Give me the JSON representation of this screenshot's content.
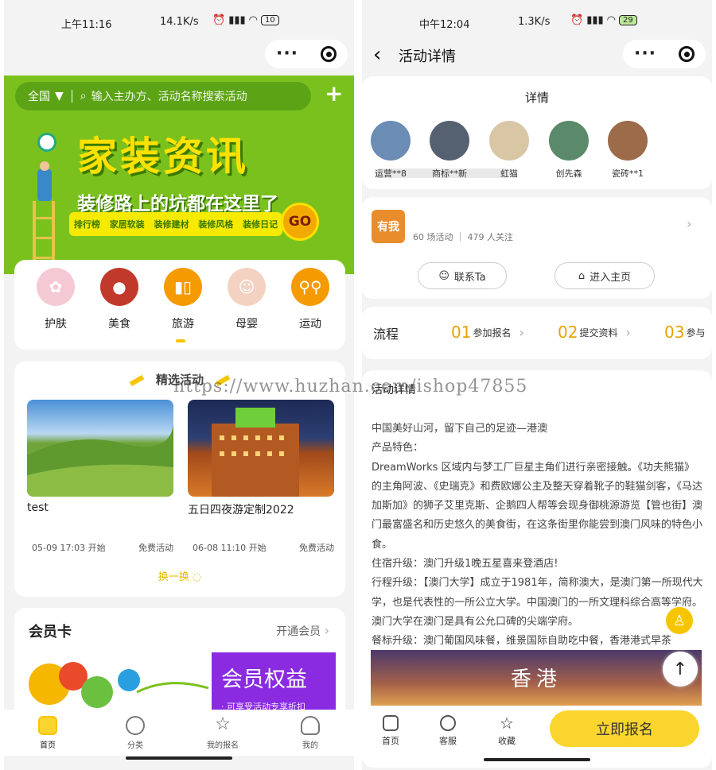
{
  "left": {
    "status": {
      "time": "上午11:16",
      "speed": "14.1K/s",
      "battery": "10"
    },
    "search": {
      "region": "全国",
      "placeholder": "输入主办方、活动名称搜索活动"
    },
    "banner": {
      "title": "家装资讯",
      "subtitle": "装修路上的坑都在这里了",
      "tags": [
        "排行榜",
        "家居软装",
        "装修建材",
        "装修风格",
        "装修日记"
      ],
      "go": "GO"
    },
    "categories": [
      {
        "label": "护肤",
        "icon": "skincare-icon",
        "color": "#f4c9d4"
      },
      {
        "label": "美食",
        "icon": "food-icon",
        "color": "#c0392b"
      },
      {
        "label": "旅游",
        "icon": "travel-icon",
        "color": "#f59a00"
      },
      {
        "label": "母婴",
        "icon": "baby-icon",
        "color": "#f3d2c1"
      },
      {
        "label": "运动",
        "icon": "bike-icon",
        "color": "#f59a00"
      }
    ],
    "featured": {
      "title": "精选活动",
      "items": [
        {
          "name": "test",
          "time": "05-09 17:03 开始",
          "price": "免费活动"
        },
        {
          "name": "五日四夜游定制2022",
          "time": "06-08 11:10 开始",
          "price": "免费活动"
        }
      ],
      "refresh": "换一换"
    },
    "member": {
      "title": "会员卡",
      "open": "开通会员",
      "banner_title": "会员权益",
      "banner_sub": "· 可享受活动专享折扣"
    },
    "tabs": [
      {
        "label": "首页",
        "icon": "home-icon",
        "active": true
      },
      {
        "label": "分类",
        "icon": "category-icon"
      },
      {
        "label": "我的报名",
        "icon": "star-icon"
      },
      {
        "label": "我的",
        "icon": "user-icon"
      }
    ]
  },
  "right": {
    "status": {
      "time": "中午12:04",
      "speed": "1.3K/s",
      "battery": "29"
    },
    "nav": {
      "title": "活动详情"
    },
    "detail_header": "详情",
    "users": [
      {
        "name": "运营**8",
        "color": "#6b8cb5"
      },
      {
        "name": "商标**新",
        "color": "#556070"
      },
      {
        "name": "虹猫",
        "color": "#d9c6a5"
      },
      {
        "name": "创先森",
        "color": "#5a8a6a"
      },
      {
        "name": "瓷砖**1",
        "color": "#9c6b4a"
      }
    ],
    "org": {
      "logo": "有我",
      "meta": "60 场活动 ｜ 479 人关注",
      "contact": "联系Ta",
      "homepage": "进入主页"
    },
    "flow": {
      "title": "流程",
      "steps": [
        {
          "no": "01",
          "label": "参加报名"
        },
        {
          "no": "02",
          "label": "提交资料"
        },
        {
          "no": "03",
          "label": "参与"
        }
      ]
    },
    "details": {
      "heading": "活动详情",
      "lines": [
        "中国美好山河，留下自己的足迹—港澳",
        "产品特色：",
        "DreamWorks 区域内与梦工厂巨星主角们进行亲密接触。《功夫熊猫》的主角阿波、《史瑞克》和费欧娜公主及整天穿着靴子的鞋猫剑客，《马达加斯加》的狮子艾里克斯、企鹅四人帮等会现身御桃源游览【管也街】澳门最富盛名和历史悠久的美食街，在这条街里你能尝到澳门风味的特色小食。",
        "住宿升级：澳门升级1晚五星喜来登酒店!",
        "行程升级：【澳门大学】成立于1981年，简称澳大，是澳门第一所现代大学，也是代表性的一所公立大学。中国澳门的一所文理科综合高等学府。澳门大学在澳门是具有公允口碑的尖端学府。",
        "餐标升级：澳门葡国风味餐，维景国际自助吃中餐，香港港式早茶"
      ],
      "image_text": "香港"
    },
    "tabs": [
      {
        "label": "首页",
        "icon": "home-icon"
      },
      {
        "label": "客服",
        "icon": "service-icon"
      },
      {
        "label": "收藏",
        "icon": "star-icon"
      }
    ],
    "signup": "立即报名"
  },
  "watermark": "https://www.huzhan.com/ishop47855",
  "colors": {
    "accent": "#fad52e",
    "banner_green": "#7bc11e",
    "orange": "#e8a300"
  }
}
